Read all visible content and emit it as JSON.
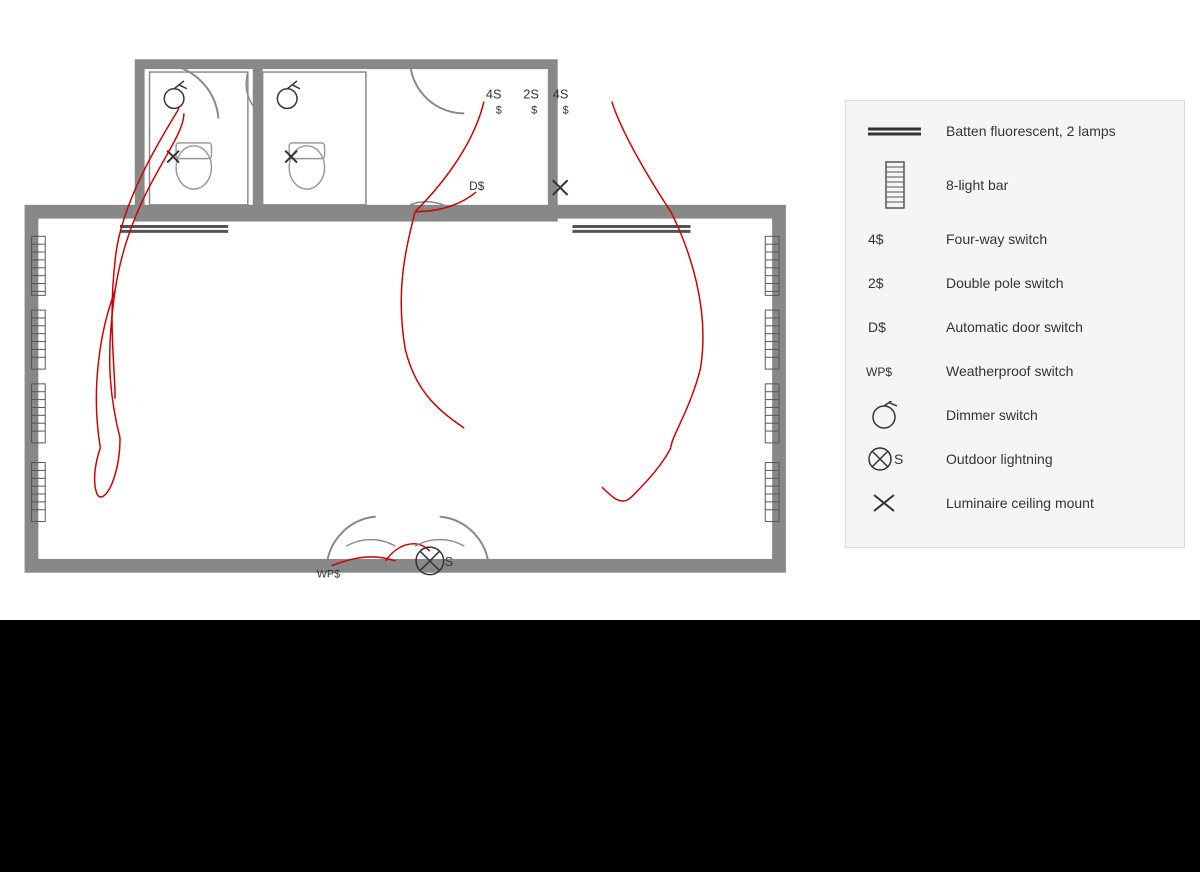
{
  "legend": {
    "items": [
      {
        "symbol": "batten-fluorescent",
        "label": "Batten fluorescent, 2 lamps"
      },
      {
        "symbol": "8-light-bar",
        "label": "8-light bar"
      },
      {
        "symbol": "four-way-switch",
        "label": "Four-way switch"
      },
      {
        "symbol": "double-pole-switch",
        "label": "Double pole switch"
      },
      {
        "symbol": "automatic-door-switch",
        "label": "Automatic door switch"
      },
      {
        "symbol": "weatherproof-switch",
        "label": "Weatherproof switch"
      },
      {
        "symbol": "dimmer-switch",
        "label": "Dimmer switch"
      },
      {
        "symbol": "outdoor-lightning",
        "label": "Outdoor lightning"
      },
      {
        "symbol": "luminaire-ceiling-mount",
        "label": "Luminaire ceiling mount"
      }
    ]
  }
}
